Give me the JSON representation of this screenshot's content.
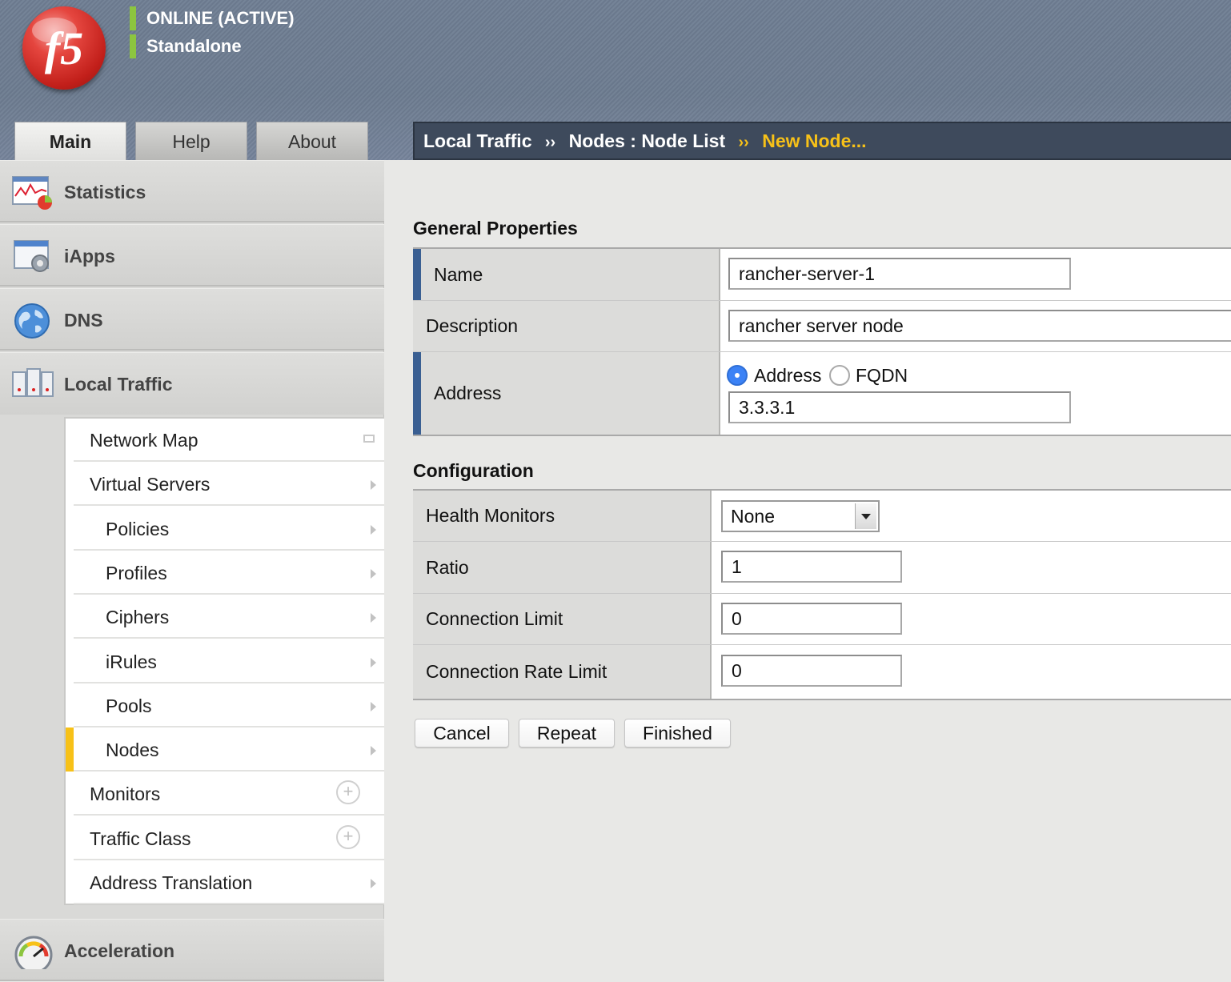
{
  "header": {
    "status": "ONLINE (ACTIVE)",
    "mode": "Standalone",
    "logo_text": "f5"
  },
  "tabs": [
    {
      "label": "Main",
      "active": true
    },
    {
      "label": "Help",
      "active": false
    },
    {
      "label": "About",
      "active": false
    }
  ],
  "breadcrumb": {
    "items": [
      "Local Traffic",
      "Nodes : Node List"
    ],
    "current": "New Node...",
    "separator": "››"
  },
  "sidebar": {
    "sections": [
      {
        "label": "Statistics",
        "icon": "statistics-icon"
      },
      {
        "label": "iApps",
        "icon": "iapps-icon"
      },
      {
        "label": "DNS",
        "icon": "dns-globe-icon"
      },
      {
        "label": "Local Traffic",
        "icon": "local-traffic-icon"
      },
      {
        "label": "Acceleration",
        "icon": "acceleration-gauge-icon"
      }
    ],
    "local_traffic_items": [
      {
        "label": "Network Map",
        "child": false,
        "marker": "map"
      },
      {
        "label": "Virtual Servers",
        "child": false,
        "marker": "arrow"
      },
      {
        "label": "Policies",
        "child": true,
        "marker": "arrow"
      },
      {
        "label": "Profiles",
        "child": true,
        "marker": "arrow"
      },
      {
        "label": "Ciphers",
        "child": true,
        "marker": "arrow"
      },
      {
        "label": "iRules",
        "child": true,
        "marker": "arrow"
      },
      {
        "label": "Pools",
        "child": true,
        "marker": "arrow"
      },
      {
        "label": "Nodes",
        "child": true,
        "marker": "arrow",
        "selected": true
      },
      {
        "label": "Monitors",
        "child": false,
        "marker": "plus"
      },
      {
        "label": "Traffic Class",
        "child": false,
        "marker": "plus"
      },
      {
        "label": "Address Translation",
        "child": false,
        "marker": "arrow"
      }
    ]
  },
  "general": {
    "title": "General Properties",
    "name_label": "Name",
    "name_value": "rancher-server-1",
    "description_label": "Description",
    "description_value": "rancher server node",
    "address_label": "Address",
    "address_option": "Address",
    "fqdn_option": "FQDN",
    "address_type_selected": "Address",
    "address_value": "3.3.3.1"
  },
  "configuration": {
    "title": "Configuration",
    "health_monitors_label": "Health Monitors",
    "health_monitors_value": "None",
    "ratio_label": "Ratio",
    "ratio_value": "1",
    "connection_limit_label": "Connection Limit",
    "connection_limit_value": "0",
    "connection_rate_limit_label": "Connection Rate Limit",
    "connection_rate_limit_value": "0"
  },
  "buttons": {
    "cancel": "Cancel",
    "repeat": "Repeat",
    "finished": "Finished"
  },
  "colors": {
    "header_bg": "#6e7d92",
    "breadcrumb_bg": "#3e4a5c",
    "breadcrumb_current": "#f7c118",
    "status_bar": "#8cc53f",
    "required_marker": "#3a5f92",
    "radio_selected": "#3b82f6",
    "selected_item_marker": "#f7c118"
  }
}
